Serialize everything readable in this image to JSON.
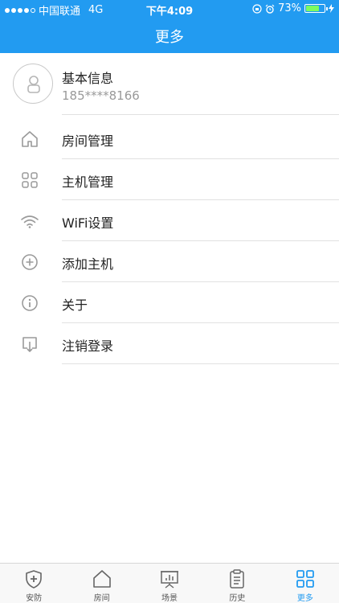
{
  "status_bar": {
    "carrier": "中国联通",
    "network": "4G",
    "time": "下午4:09",
    "battery": "73%",
    "battery_level": 0.73
  },
  "header": {
    "title": "更多"
  },
  "profile": {
    "name": "基本信息",
    "phone": "185****8166",
    "avatar_icon": "user-icon"
  },
  "menu": [
    {
      "label": "房间管理",
      "icon": "home-icon"
    },
    {
      "label": "主机管理",
      "icon": "grid-icon"
    },
    {
      "label": "WiFi设置",
      "icon": "wifi-icon"
    },
    {
      "label": "添加主机",
      "icon": "plus-circle-icon"
    },
    {
      "label": "关于",
      "icon": "info-icon"
    },
    {
      "label": "注销登录",
      "icon": "logout-icon"
    }
  ],
  "tabbar": {
    "tabs": [
      {
        "label": "安防",
        "icon": "shield-plus-icon",
        "active": false
      },
      {
        "label": "房间",
        "icon": "home-icon",
        "active": false
      },
      {
        "label": "场景",
        "icon": "scene-icon",
        "active": false
      },
      {
        "label": "历史",
        "icon": "clipboard-icon",
        "active": false
      },
      {
        "label": "更多",
        "icon": "grid-icon",
        "active": true
      }
    ]
  },
  "colors": {
    "accent": "#229bf1",
    "text": "#222222",
    "muted": "#999999",
    "divider": "#e1e1e1"
  }
}
